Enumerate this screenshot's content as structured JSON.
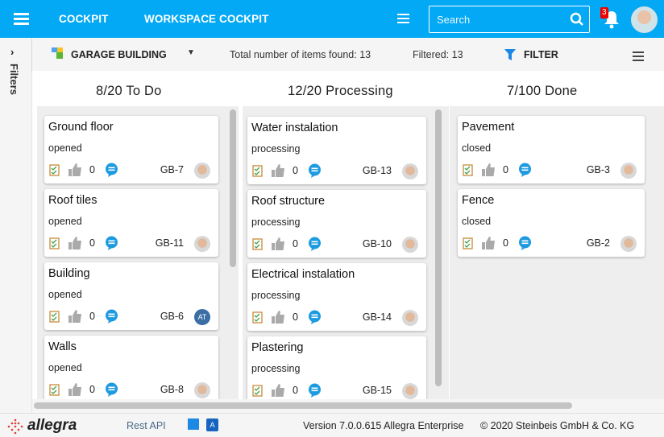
{
  "header": {
    "nav": [
      "COCKPIT",
      "WORKSPACE COCKPIT"
    ],
    "search_placeholder": "Search",
    "notifications": "3"
  },
  "sidebar": {
    "label": "Filters"
  },
  "toolbar": {
    "project": "GARAGE BUILDING",
    "total": "Total number of items found: 13",
    "filtered": "Filtered: 13",
    "filter_label": "FILTER"
  },
  "columns": [
    {
      "title": "8/20  To Do",
      "cards": [
        {
          "title": "Ground floor",
          "status": "opened",
          "likes": "0",
          "key": "GB-7"
        },
        {
          "title": "Roof tiles",
          "status": "opened",
          "likes": "0",
          "key": "GB-11"
        },
        {
          "title": "Building",
          "status": "opened",
          "likes": "0",
          "key": "GB-6",
          "avatar": "AT"
        },
        {
          "title": "Walls",
          "status": "opened",
          "likes": "0",
          "key": "GB-8"
        }
      ]
    },
    {
      "title": "12/20  Processing",
      "cards": [
        {
          "title": "Water instalation",
          "status": "processing",
          "likes": "0",
          "key": "GB-13"
        },
        {
          "title": "Roof structure",
          "status": "processing",
          "likes": "0",
          "key": "GB-10"
        },
        {
          "title": "Electrical instalation",
          "status": "processing",
          "likes": "0",
          "key": "GB-14"
        },
        {
          "title": "Plastering",
          "status": "processing",
          "likes": "0",
          "key": "GB-15"
        }
      ]
    },
    {
      "title": "7/100  Done",
      "cards": [
        {
          "title": "Pavement",
          "status": "closed",
          "likes": "0",
          "key": "GB-3"
        },
        {
          "title": "Fence",
          "status": "closed",
          "likes": "0",
          "key": "GB-2"
        }
      ]
    }
  ],
  "footer": {
    "logo": "allegra",
    "rest_api": "Rest API",
    "version": "Version 7.0.0.615 Allegra Enterprise",
    "copyright": "© 2020 Steinbeis GmbH & Co. KG"
  },
  "colors": {
    "primary": "#03a9f4",
    "comment": "#1e9be0",
    "badge": "#e00000"
  }
}
